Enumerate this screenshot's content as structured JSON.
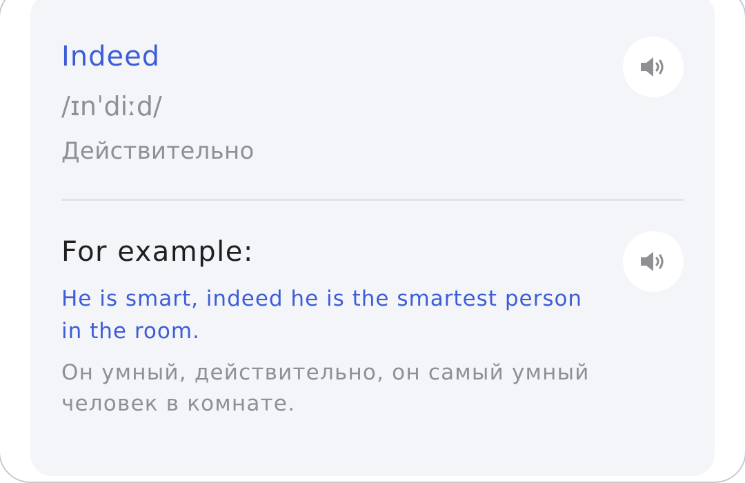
{
  "word_card": {
    "word": "Indeed",
    "transcription": "/ɪnˈdiːd/",
    "translation": "Действительно",
    "word_sound_icon": "speaker-icon"
  },
  "example": {
    "heading": "For example:",
    "sentence_en": "He is smart, indeed he is the smartest person in the room.",
    "sentence_ru": "Он умный, действительно, он самый умный человек в комнате.",
    "sound_icon": "speaker-icon"
  },
  "colors": {
    "accent": "#3d5dd8",
    "muted_text": "#8e9094",
    "heading_text": "#1f1f22",
    "card_background": "#f4f5f9",
    "icon": "#8e9094"
  }
}
